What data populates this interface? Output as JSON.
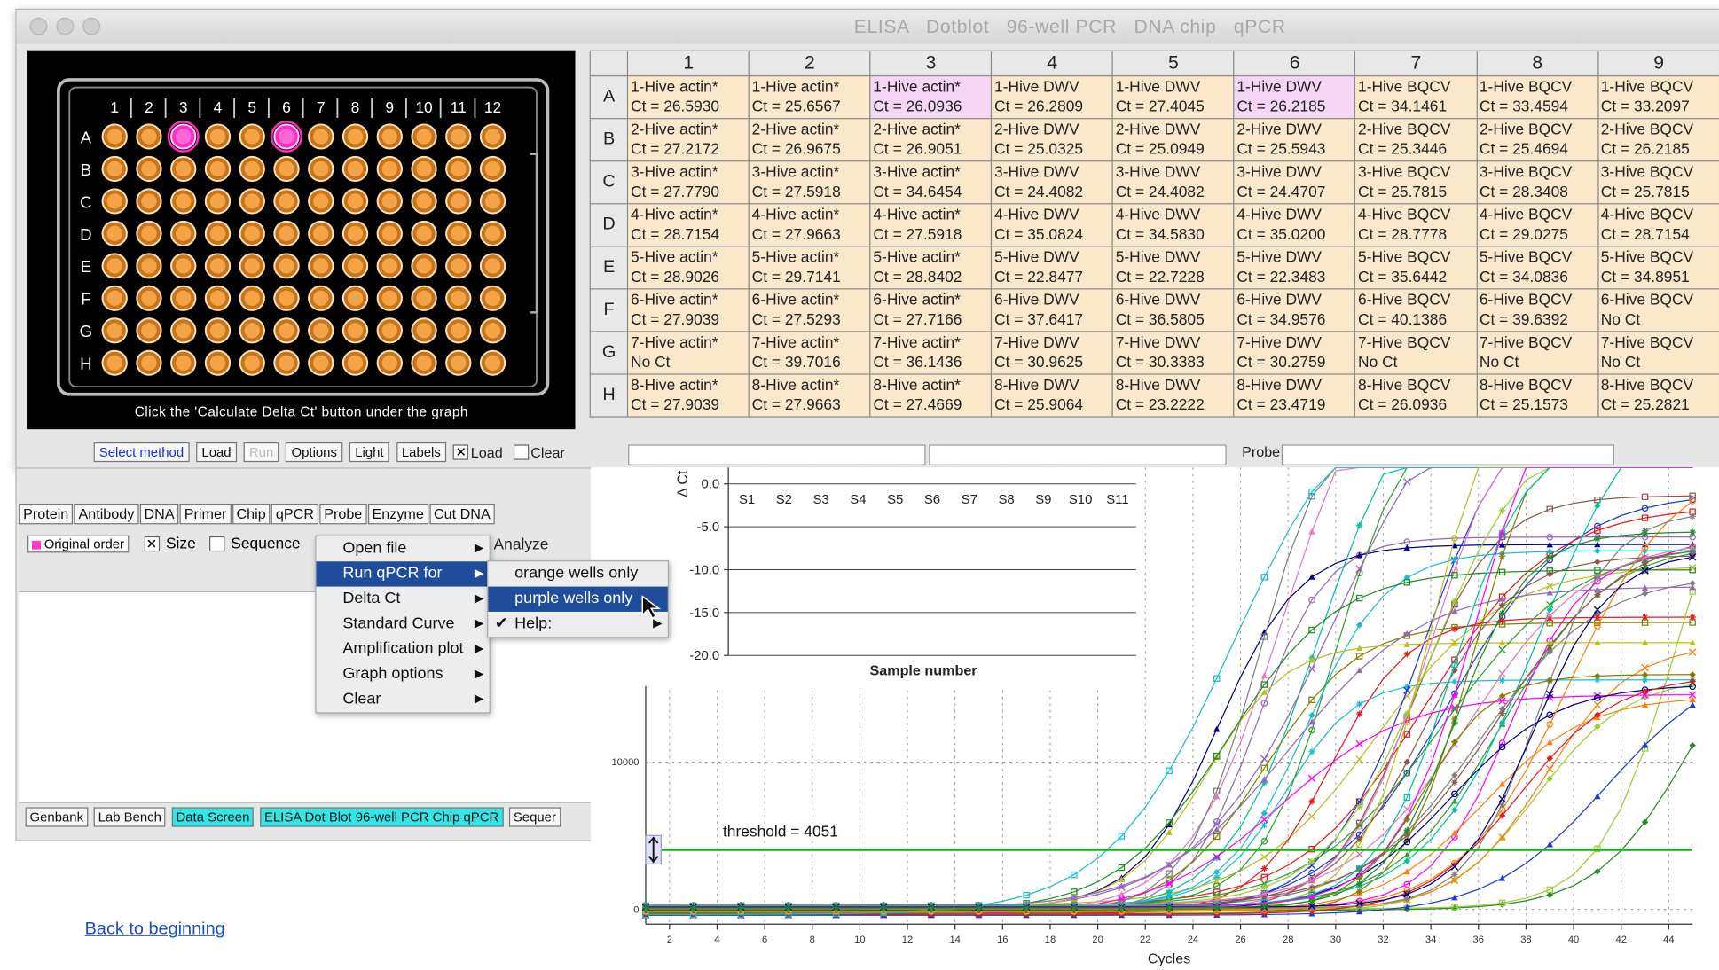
{
  "window": {
    "title": "ELISA   Dotblot   96-well PCR   DNA chip   qPCR",
    "plate_caption": "Click the 'Calculate Delta Ct' button under the graph",
    "plate_cols": [
      "1",
      "2",
      "3",
      "4",
      "5",
      "6",
      "7",
      "8",
      "9",
      "10",
      "11",
      "12"
    ],
    "plate_rows": [
      "A",
      "B",
      "C",
      "D",
      "E",
      "F",
      "G",
      "H"
    ],
    "selected_wells": [
      "A3",
      "A6"
    ],
    "colors": {
      "well_orange": "#f5a347",
      "well_purple": "#ff2ec4",
      "cell_orange": "#fbe7c9",
      "cell_purple": "#f5d6f5"
    }
  },
  "results_grid": {
    "columns": [
      "1",
      "2",
      "3",
      "4",
      "5",
      "6",
      "7",
      "8",
      "9"
    ],
    "rows": [
      {
        "label": "A",
        "cells": [
          {
            "name": "1-Hive actin*",
            "ct": "Ct = 26.5930"
          },
          {
            "name": "1-Hive actin*",
            "ct": "Ct = 25.6567"
          },
          {
            "name": "1-Hive actin*",
            "ct": "Ct = 26.0936",
            "purple": true
          },
          {
            "name": "1-Hive DWV",
            "ct": "Ct = 26.2809"
          },
          {
            "name": "1-Hive DWV",
            "ct": "Ct = 27.4045"
          },
          {
            "name": "1-Hive DWV",
            "ct": "Ct = 26.2185",
            "purple": true
          },
          {
            "name": "1-Hive BQCV",
            "ct": "Ct = 34.1461"
          },
          {
            "name": "1-Hive BQCV",
            "ct": "Ct = 33.4594"
          },
          {
            "name": "1-Hive BQCV",
            "ct": "Ct = 33.2097"
          }
        ]
      },
      {
        "label": "B",
        "cells": [
          {
            "name": "2-Hive actin*",
            "ct": "Ct = 27.2172"
          },
          {
            "name": "2-Hive actin*",
            "ct": "Ct = 26.9675"
          },
          {
            "name": "2-Hive actin*",
            "ct": "Ct = 26.9051"
          },
          {
            "name": "2-Hive DWV",
            "ct": "Ct = 25.0325"
          },
          {
            "name": "2-Hive DWV",
            "ct": "Ct = 25.0949"
          },
          {
            "name": "2-Hive DWV",
            "ct": "Ct = 25.5943"
          },
          {
            "name": "2-Hive BQCV",
            "ct": "Ct = 25.3446"
          },
          {
            "name": "2-Hive BQCV",
            "ct": "Ct = 25.4694"
          },
          {
            "name": "2-Hive BQCV",
            "ct": "Ct = 26.2185"
          }
        ]
      },
      {
        "label": "C",
        "cells": [
          {
            "name": "3-Hive actin*",
            "ct": "Ct = 27.7790"
          },
          {
            "name": "3-Hive actin*",
            "ct": "Ct = 27.5918"
          },
          {
            "name": "3-Hive actin*",
            "ct": "Ct = 34.6454"
          },
          {
            "name": "3-Hive DWV",
            "ct": "Ct = 24.4082"
          },
          {
            "name": "3-Hive DWV",
            "ct": "Ct = 24.4082"
          },
          {
            "name": "3-Hive DWV",
            "ct": "Ct = 24.4707"
          },
          {
            "name": "3-Hive BQCV",
            "ct": "Ct = 25.7815"
          },
          {
            "name": "3-Hive BQCV",
            "ct": "Ct = 28.3408"
          },
          {
            "name": "3-Hive BQCV",
            "ct": "Ct = 25.7815"
          }
        ]
      },
      {
        "label": "D",
        "cells": [
          {
            "name": "4-Hive actin*",
            "ct": "Ct = 28.7154"
          },
          {
            "name": "4-Hive actin*",
            "ct": "Ct = 27.9663"
          },
          {
            "name": "4-Hive actin*",
            "ct": "Ct = 27.5918"
          },
          {
            "name": "4-Hive DWV",
            "ct": "Ct = 35.0824"
          },
          {
            "name": "4-Hive DWV",
            "ct": "Ct = 34.5830"
          },
          {
            "name": "4-Hive DWV",
            "ct": "Ct = 35.0200"
          },
          {
            "name": "4-Hive BQCV",
            "ct": "Ct = 28.7778"
          },
          {
            "name": "4-Hive BQCV",
            "ct": "Ct = 29.0275"
          },
          {
            "name": "4-Hive BQCV",
            "ct": "Ct = 28.7154"
          }
        ]
      },
      {
        "label": "E",
        "cells": [
          {
            "name": "5-Hive actin*",
            "ct": "Ct = 28.9026"
          },
          {
            "name": "5-Hive actin*",
            "ct": "Ct = 29.7141"
          },
          {
            "name": "5-Hive actin*",
            "ct": "Ct = 28.8402"
          },
          {
            "name": "5-Hive DWV",
            "ct": "Ct = 22.8477"
          },
          {
            "name": "5-Hive DWV",
            "ct": "Ct = 22.7228"
          },
          {
            "name": "5-Hive DWV",
            "ct": "Ct = 22.3483"
          },
          {
            "name": "5-Hive BQCV",
            "ct": "Ct = 35.6442"
          },
          {
            "name": "5-Hive BQCV",
            "ct": "Ct = 34.0836"
          },
          {
            "name": "5-Hive BQCV",
            "ct": "Ct = 34.8951"
          }
        ]
      },
      {
        "label": "F",
        "cells": [
          {
            "name": "6-Hive actin*",
            "ct": "Ct = 27.9039"
          },
          {
            "name": "6-Hive actin*",
            "ct": "Ct = 27.5293"
          },
          {
            "name": "6-Hive actin*",
            "ct": "Ct = 27.7166"
          },
          {
            "name": "6-Hive DWV",
            "ct": "Ct = 37.6417"
          },
          {
            "name": "6-Hive DWV",
            "ct": "Ct = 36.5805"
          },
          {
            "name": "6-Hive DWV",
            "ct": "Ct = 34.9576"
          },
          {
            "name": "6-Hive BQCV",
            "ct": "Ct = 40.1386"
          },
          {
            "name": "6-Hive BQCV",
            "ct": "Ct = 39.6392"
          },
          {
            "name": "6-Hive BQCV",
            "ct": "No Ct"
          }
        ]
      },
      {
        "label": "G",
        "cells": [
          {
            "name": "7-Hive actin*",
            "ct": "No Ct"
          },
          {
            "name": "7-Hive actin*",
            "ct": "Ct = 39.7016"
          },
          {
            "name": "7-Hive actin*",
            "ct": "Ct = 36.1436"
          },
          {
            "name": "7-Hive DWV",
            "ct": "Ct = 30.9625"
          },
          {
            "name": "7-Hive DWV",
            "ct": "Ct = 30.3383"
          },
          {
            "name": "7-Hive DWV",
            "ct": "Ct = 30.2759"
          },
          {
            "name": "7-Hive BQCV",
            "ct": "No Ct"
          },
          {
            "name": "7-Hive BQCV",
            "ct": "No Ct"
          },
          {
            "name": "7-Hive BQCV",
            "ct": "No Ct"
          }
        ]
      },
      {
        "label": "H",
        "cells": [
          {
            "name": "8-Hive actin*",
            "ct": "Ct = 27.9039"
          },
          {
            "name": "8-Hive actin*",
            "ct": "Ct = 27.9663"
          },
          {
            "name": "8-Hive actin*",
            "ct": "Ct = 27.4669"
          },
          {
            "name": "8-Hive DWV",
            "ct": "Ct = 25.9064"
          },
          {
            "name": "8-Hive DWV",
            "ct": "Ct = 23.2222"
          },
          {
            "name": "8-Hive DWV",
            "ct": "Ct = 23.4719"
          },
          {
            "name": "8-Hive BQCV",
            "ct": "Ct = 26.0936"
          },
          {
            "name": "8-Hive BQCV",
            "ct": "Ct = 25.1573"
          },
          {
            "name": "8-Hive BQCV",
            "ct": "Ct = 25.2821"
          }
        ]
      }
    ]
  },
  "toolbar": {
    "select_method": "Select method",
    "load": "Load",
    "run": "Run",
    "options": "Options",
    "light": "Light",
    "labels": "Labels",
    "load_check": "Load",
    "clear_check": "Clear",
    "load_checked": true,
    "probe_label": "Probe:"
  },
  "tool_tabs": [
    "Protein",
    "Antibody",
    "DNA",
    "Primer",
    "Chip",
    "qPCR",
    "Probe",
    "Enzyme",
    "Cut DNA"
  ],
  "options_row": {
    "original_order": "Original order",
    "size": "Size",
    "size_checked": true,
    "sequence": "Sequence",
    "sequence_checked": false,
    "analyze": "Analyze"
  },
  "bottom_nav": {
    "genbank": "Genbank",
    "lab_bench": "Lab Bench",
    "data_screen": "Data Screen",
    "protocols": "ELISA  Dot Blot  96-well PCR  Chip  qPCR",
    "sequence": "Sequer"
  },
  "main_menu": [
    {
      "label": "Open file"
    },
    {
      "label": "Run qPCR for",
      "highlighted": true
    },
    {
      "label": "Delta Ct"
    },
    {
      "label": "Standard Curve"
    },
    {
      "label": "Amplification plot"
    },
    {
      "label": "Graph options"
    },
    {
      "label": "Clear"
    }
  ],
  "submenu": [
    {
      "label": "orange wells only"
    },
    {
      "label": "purple wells only",
      "highlighted": true
    },
    {
      "label": "Help:",
      "checked": true
    }
  ],
  "inset_axis_label": "Δ Ct",
  "threshold_label": "threshold = 4051",
  "back_link": "Back to beginning",
  "chart_data": [
    {
      "type": "line",
      "xlabel": "Cycles",
      "x_ticks": [
        2,
        4,
        6,
        8,
        10,
        12,
        14,
        16,
        18,
        20,
        22,
        24,
        26,
        28,
        30,
        32,
        34,
        36,
        38,
        40,
        42,
        44
      ],
      "y_ticks": [
        0,
        10000
      ],
      "xlim": [
        1,
        45
      ],
      "ylim": [
        -1000,
        30000
      ],
      "threshold": 4051,
      "grid": true,
      "series_note_count": 48
    },
    {
      "type": "bar",
      "xlabel": "Sample number",
      "categories": [
        "S1",
        "S2",
        "S3",
        "S4",
        "S5",
        "S6",
        "S7",
        "S8",
        "S9",
        "S10",
        "S11"
      ],
      "y_ticks": [
        0.0,
        -5.0,
        -10.0,
        -15.0,
        -20.0
      ],
      "ylim": [
        -20,
        0
      ],
      "grid": true
    }
  ]
}
